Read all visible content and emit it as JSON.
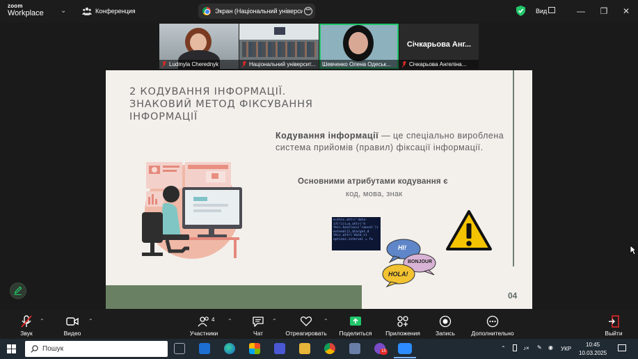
{
  "app": {
    "logo_line1": "zoom",
    "logo_line2": "Workplace",
    "meeting_label": "Конференция",
    "share_title": "Экран (Національний університ",
    "view_label": "Вид"
  },
  "participants": [
    {
      "name": "Ludmyla Cherednyk",
      "muted": true
    },
    {
      "name": "Національний університ...",
      "muted": true
    },
    {
      "name": "Шевченко Олена Одеськ...",
      "muted": false,
      "active": true
    },
    {
      "name": "Січкарьова Ангеліна...",
      "muted": true,
      "tile_text": "Січкарьова  Анг..."
    }
  ],
  "slide": {
    "title": "2 КОДУВАННЯ ІНФОРМАЦІЇ. ЗНАКОВИЙ МЕТОД ФІКСУВАННЯ ІНФОРМАЦІЇ",
    "definition_term": "Кодування інформації",
    "definition_rest": " — це спеціально вироблена система прийомів (правил) фіксації інформації.",
    "attributes_heading": "Основними атрибутами кодування є",
    "attributes_values": "код, мова, знак",
    "bubble1": "HI!",
    "bubble2": "BONJOUR",
    "bubble3": "HOLA!",
    "page_number": "04",
    "code_lines": [
      "e=this.attr('data-",
      "if(!i)i=e.attr('h",
      "this.hasClass('cancel'))",
      "extend({},$target.d",
      "this.attr('data-sl",
      "options.interval = fa"
    ]
  },
  "toolbar": {
    "audio": "Звук",
    "video": "Видео",
    "participants": "Участники",
    "participants_count": "4",
    "chat": "Чат",
    "react": "Отреагировать",
    "share": "Поделиться",
    "apps": "Приложения",
    "record": "Запись",
    "more": "Дополнительно",
    "leave": "Выйти"
  },
  "taskbar": {
    "search_placeholder": "Пошук",
    "lang": "УКР",
    "time": "10:45",
    "date": "10.03.2025",
    "badge": "15"
  },
  "colors": {
    "accent_green": "#21c76a",
    "slide_bg": "#f3f0ec",
    "slide_green": "#6a8062",
    "leave_red": "#e02828"
  }
}
